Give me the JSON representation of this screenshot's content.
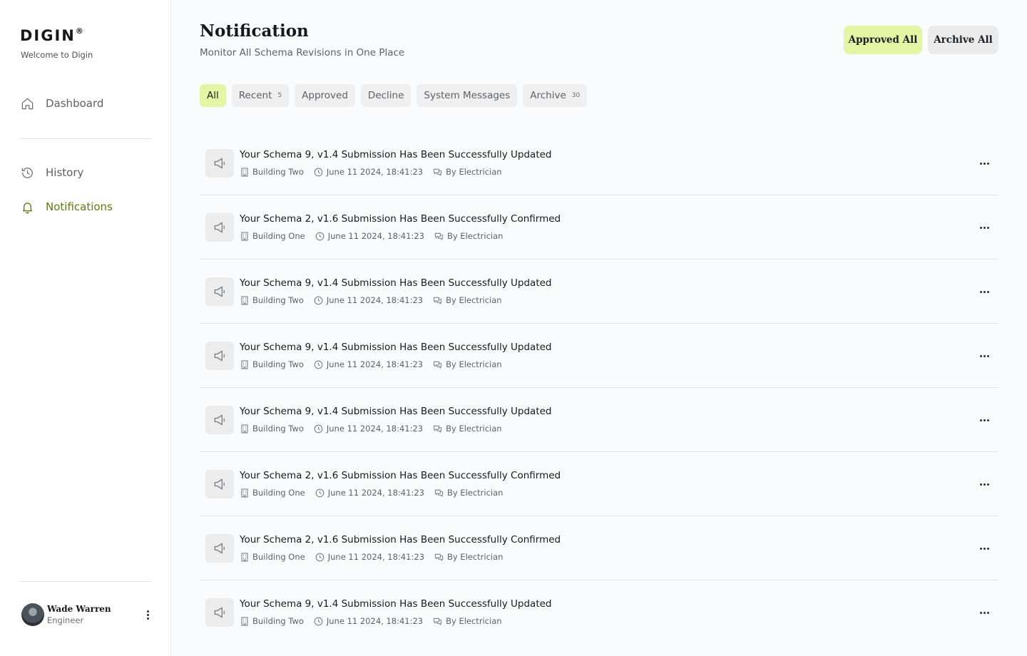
{
  "brand": {
    "name": "DIGIN",
    "mark": "®",
    "welcome": "Welcome to Digin"
  },
  "nav": {
    "dashboard": "Dashboard",
    "history": "History",
    "notifications": "Notifications"
  },
  "user": {
    "name": "Wade Warren",
    "role": "Engineer"
  },
  "header": {
    "title": "Notification",
    "subtitle": "Monitor All Schema Revisions in One Place",
    "approve_all": "Approved All",
    "archive_all": "Archive All"
  },
  "tabs": [
    {
      "label": "All",
      "count": "",
      "active": true
    },
    {
      "label": "Recent",
      "count": "5",
      "active": false
    },
    {
      "label": "Approved",
      "count": "",
      "active": false
    },
    {
      "label": "Decline",
      "count": "",
      "active": false
    },
    {
      "label": "System Messages",
      "count": "",
      "active": false
    },
    {
      "label": "Archive",
      "count": "30",
      "active": false
    }
  ],
  "notifications": [
    {
      "title": "Your Schema 9, v1.4 Submission Has Been Successfully Updated",
      "building": "Building Two",
      "time": "June 11 2024, 18:41:23",
      "author": "By Electrician"
    },
    {
      "title": "Your Schema 2, v1.6 Submission Has Been Successfully Confirmed",
      "building": "Building One",
      "time": "June 11 2024, 18:41:23",
      "author": "By Electrician"
    },
    {
      "title": "Your Schema 9, v1.4 Submission Has Been Successfully Updated",
      "building": "Building Two",
      "time": "June 11 2024, 18:41:23",
      "author": "By Electrician"
    },
    {
      "title": "Your Schema 9, v1.4 Submission Has Been Successfully Updated",
      "building": "Building Two",
      "time": "June 11 2024, 18:41:23",
      "author": "By Electrician"
    },
    {
      "title": "Your Schema 9, v1.4 Submission Has Been Successfully Updated",
      "building": "Building Two",
      "time": "June 11 2024, 18:41:23",
      "author": "By Electrician"
    },
    {
      "title": "Your Schema 2, v1.6 Submission Has Been Successfully Confirmed",
      "building": "Building One",
      "time": "June 11 2024, 18:41:23",
      "author": "By Electrician"
    },
    {
      "title": "Your Schema 2, v1.6 Submission Has Been Successfully Confirmed",
      "building": "Building One",
      "time": "June 11 2024, 18:41:23",
      "author": "By Electrician"
    },
    {
      "title": "Your Schema 9, v1.4 Submission Has Been Successfully Updated",
      "building": "Building Two",
      "time": "June 11 2024, 18:41:23",
      "author": "By Electrician"
    }
  ],
  "colors": {
    "accent": "#e4f5a5",
    "active_nav": "#5c7a12"
  }
}
